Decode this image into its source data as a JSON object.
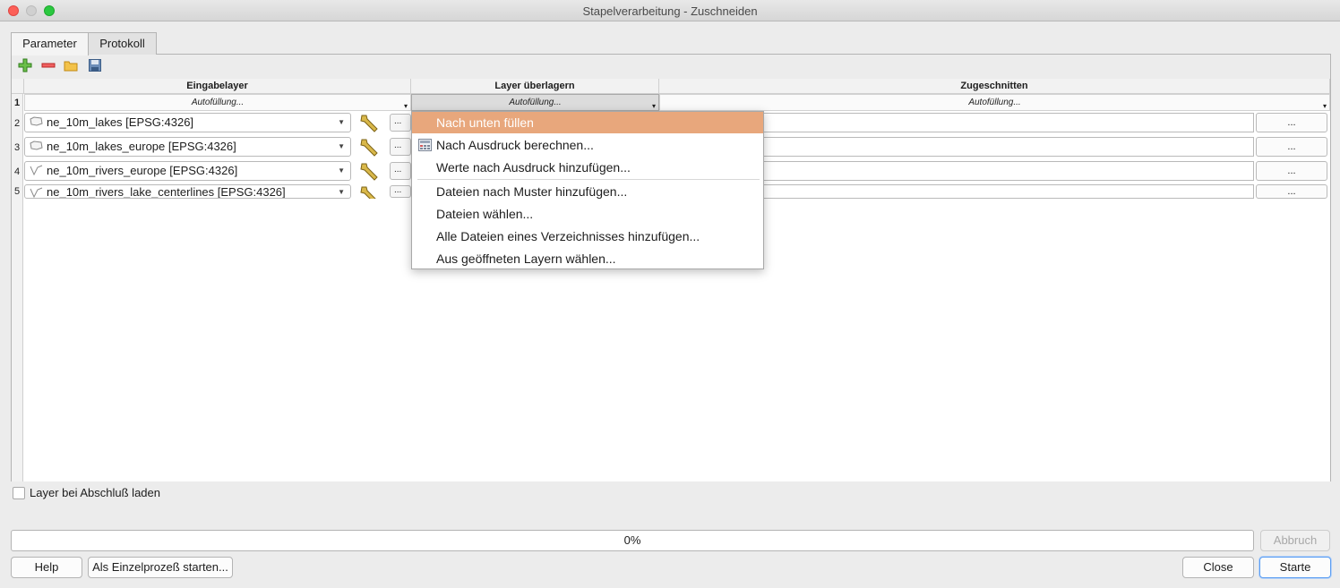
{
  "window": {
    "title": "Stapelverarbeitung - Zuschneiden"
  },
  "tabs": [
    {
      "label": "Parameter"
    },
    {
      "label": "Protokoll"
    }
  ],
  "table": {
    "columns": [
      "Eingabelayer",
      "Layer überlagern",
      "Zugeschnitten"
    ],
    "autofill_label": "Autofüllung...",
    "rows": [
      {
        "num": "1"
      },
      {
        "num": "2",
        "layer": "ne_10m_lakes [EPSG:4326]",
        "type": "polygon"
      },
      {
        "num": "3",
        "layer": "ne_10m_lakes_europe [EPSG:4326]",
        "type": "polygon"
      },
      {
        "num": "4",
        "layer": "ne_10m_rivers_europe [EPSG:4326]",
        "type": "line"
      },
      {
        "num": "5",
        "layer": "ne_10m_rivers_lake_centerlines [EPSG:4326]",
        "type": "line"
      }
    ],
    "browse_small": "...",
    "browse_label": "..."
  },
  "menu": {
    "items": [
      "Nach unten füllen",
      "Nach Ausdruck berechnen...",
      "Werte nach Ausdruck hinzufügen...",
      "Dateien nach Muster hinzufügen...",
      "Dateien wählen...",
      "Alle Dateien eines Verzeichnisses hinzufügen...",
      "Aus geöffneten Layern wählen..."
    ],
    "highlight_color": "#e8a77c"
  },
  "load_on_finish": {
    "label": "Layer bei Abschluß laden",
    "checked": false
  },
  "progress": {
    "text": "0%",
    "value": 0
  },
  "buttons": {
    "abort": "Abbruch",
    "help": "Help",
    "single": "Als Einzelprozeß starten...",
    "close": "Close",
    "start": "Starte"
  },
  "colors": {
    "close": "#fc5f57",
    "maximize": "#2bc840",
    "default_button_border": "#5b9df2"
  }
}
